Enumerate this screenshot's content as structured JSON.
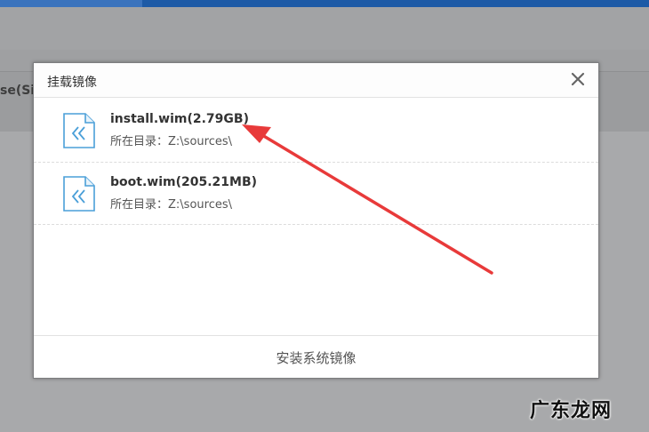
{
  "background": {
    "partial_text": "se(Si"
  },
  "dialog": {
    "title": "挂载镜像",
    "close_icon": "close-icon",
    "items": [
      {
        "name": "install.wim(2.79GB)",
        "dir": "所在目录：Z:\\sources\\",
        "icon": "wim-file-icon"
      },
      {
        "name": "boot.wim(205.21MB)",
        "dir": "所在目录：Z:\\sources\\",
        "icon": "wim-file-icon"
      }
    ],
    "install_button": "安装系统镜像"
  },
  "colors": {
    "accent": "#1d5aa6",
    "arrow": "#e83a3a",
    "icon_blue": "#4a9fd8"
  },
  "watermark": "广东龙网"
}
